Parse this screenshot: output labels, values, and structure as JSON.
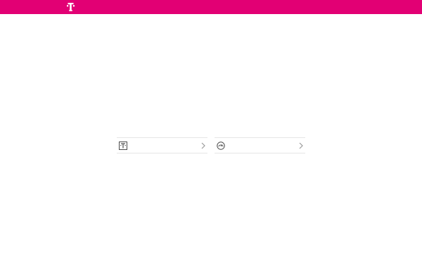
{
  "header": {
    "brand_color": "#e20074",
    "logo_icon": "telekom-t-logo"
  },
  "tiles": [
    {
      "icon": "telekom-t-box-icon",
      "label": ""
    },
    {
      "icon": "speedometer-icon",
      "label": ""
    }
  ],
  "colors": {
    "divider": "#e6e6e6",
    "icon_stroke": "#4b4b4b",
    "chevron": "#9b9b9b"
  }
}
